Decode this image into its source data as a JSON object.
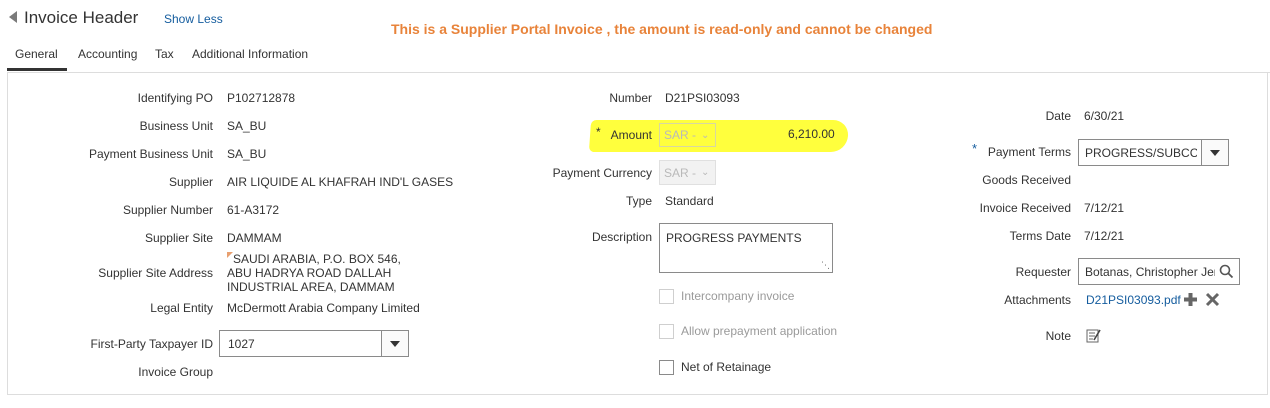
{
  "header": {
    "title": "Invoice Header",
    "toggle": "Show Less",
    "banner": "This is a Supplier Portal Invoice , the amount is read-only and cannot be changed"
  },
  "tabs": [
    {
      "label": "General",
      "active": true
    },
    {
      "label": "Accounting",
      "active": false
    },
    {
      "label": "Tax",
      "active": false
    },
    {
      "label": "Additional Information",
      "active": false
    }
  ],
  "left": {
    "identifying_po": {
      "label": "Identifying PO",
      "value": "P102712878"
    },
    "business_unit": {
      "label": "Business Unit",
      "value": "SA_BU"
    },
    "payment_business_unit": {
      "label": "Payment Business Unit",
      "value": "SA_BU"
    },
    "supplier": {
      "label": "Supplier",
      "value": "AIR LIQUIDE AL KHAFRAH IND'L GASES"
    },
    "supplier_number": {
      "label": "Supplier Number",
      "value": "61-A3172"
    },
    "supplier_site": {
      "label": "Supplier Site",
      "value": "DAMMAM"
    },
    "supplier_site_address": {
      "label": "Supplier Site Address",
      "lines": [
        "SAUDI ARABIA, P.O. BOX 546,",
        "ABU HADRYA ROAD DALLAH",
        "INDUSTRIAL AREA, DAMMAM"
      ]
    },
    "legal_entity": {
      "label": "Legal Entity",
      "value": "McDermott Arabia Company Limited"
    },
    "taxpayer_id": {
      "label": "First-Party Taxpayer ID",
      "value": "1027"
    },
    "invoice_group": {
      "label": "Invoice Group",
      "value": ""
    }
  },
  "middle": {
    "number": {
      "label": "Number",
      "value": "D21PSI03093"
    },
    "amount": {
      "required": "*",
      "label": "Amount",
      "currency": "SAR -",
      "value": "6,210.00"
    },
    "payment_currency": {
      "label": "Payment Currency",
      "currency": "SAR -"
    },
    "type": {
      "label": "Type",
      "value": "Standard"
    },
    "description": {
      "label": "Description",
      "value": "PROGRESS PAYMENTS"
    },
    "intercompany": {
      "label": "Intercompany invoice",
      "checked": false
    },
    "allow_prepayment": {
      "label": "Allow prepayment application",
      "checked": false
    },
    "net_of_retainage": {
      "label": "Net of Retainage",
      "checked": false
    }
  },
  "right": {
    "date": {
      "label": "Date",
      "value": "6/30/21"
    },
    "payment_terms": {
      "required": "*",
      "label": "Payment Terms",
      "value": "PROGRESS/SUBCC"
    },
    "goods_received": {
      "label": "Goods Received",
      "value": ""
    },
    "invoice_received": {
      "label": "Invoice Received",
      "value": "7/12/21"
    },
    "terms_date": {
      "label": "Terms Date",
      "value": "7/12/21"
    },
    "requester": {
      "label": "Requester",
      "value": "Botanas, Christopher Jer"
    },
    "attachments": {
      "label": "Attachments",
      "value": "D21PSI03093.pdf"
    },
    "note": {
      "label": "Note"
    }
  },
  "colors": {
    "link": "#145c9e",
    "banner": "#e8833a",
    "highlight": "#ffff33"
  }
}
